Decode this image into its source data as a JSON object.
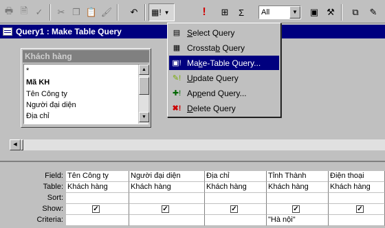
{
  "toolbar": {
    "icons": [
      "print-icon",
      "print-preview-icon",
      "spelling-icon",
      "cut-icon",
      "copy-icon",
      "paste-icon",
      "format-painter-icon",
      "undo-icon",
      "query-type-icon",
      "run-icon",
      "show-table-icon",
      "totals-icon",
      "properties-icon",
      "build-icon",
      "database-window-icon",
      "new-object-icon"
    ],
    "top_values": "All"
  },
  "window": {
    "title": "Query1 : Make Table Query"
  },
  "table": {
    "name": "Khách hàng",
    "fields": [
      "*",
      "Mã KH",
      "Tên Công ty",
      "Người đại diện",
      "Địa chỉ"
    ]
  },
  "menu": {
    "items": [
      {
        "pre": "",
        "u": "S",
        "post": "elect Query",
        "icon": "select-query-icon"
      },
      {
        "pre": "Crossta",
        "u": "b",
        "post": " Query",
        "icon": "crosstab-query-icon"
      },
      {
        "pre": "Ma",
        "u": "k",
        "post": "e-Table Query...",
        "icon": "make-table-query-icon"
      },
      {
        "pre": "",
        "u": "U",
        "post": "pdate Query",
        "icon": "update-query-icon"
      },
      {
        "pre": "Ap",
        "u": "p",
        "post": "end Query...",
        "icon": "append-query-icon"
      },
      {
        "pre": "",
        "u": "D",
        "post": "elete Query",
        "icon": "delete-query-icon"
      }
    ],
    "selected": 2
  },
  "grid": {
    "row_labels": [
      "Field:",
      "Table:",
      "Sort:",
      "Show:",
      "Criteria:"
    ],
    "columns": [
      {
        "field": "Tên Công ty",
        "table": "Khách hàng",
        "sort": "",
        "show": true,
        "criteria": ""
      },
      {
        "field": "Người đại diện",
        "table": "Khách hàng",
        "sort": "",
        "show": true,
        "criteria": ""
      },
      {
        "field": "Địa chỉ",
        "table": "Khách hàng",
        "sort": "",
        "show": true,
        "criteria": ""
      },
      {
        "field": "Tỉnh Thành",
        "table": "Khách hàng",
        "sort": "",
        "show": true,
        "criteria": "\"Hà nội\""
      },
      {
        "field": "Điện thoại",
        "table": "Khách hàng",
        "sort": "",
        "show": true,
        "criteria": ""
      }
    ]
  },
  "colors": {
    "title_bar": "#00007f",
    "highlight": "#00007f",
    "face": "#c0c0c0"
  }
}
